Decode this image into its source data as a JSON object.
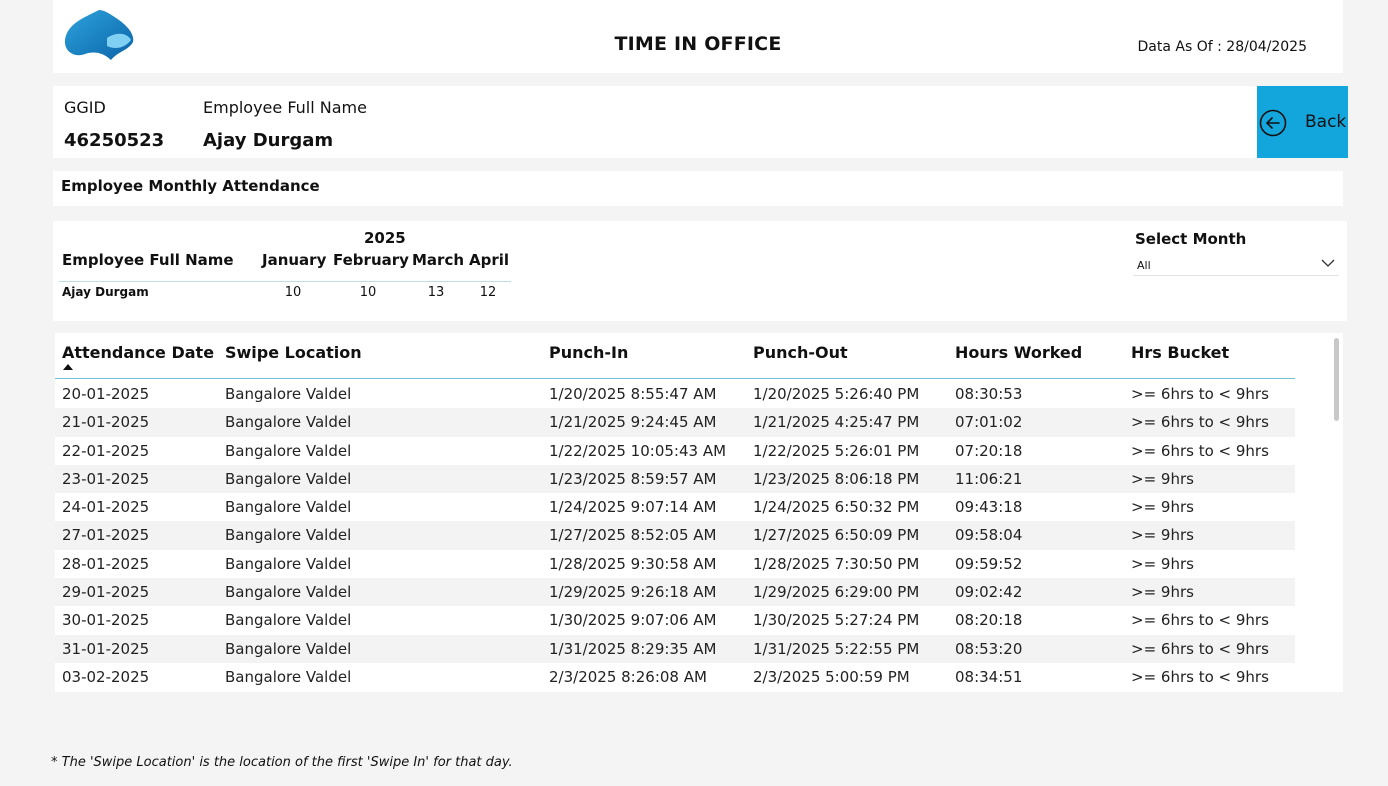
{
  "header": {
    "title": "TIME IN OFFICE",
    "data_as_of": "Data As Of : 28/04/2025",
    "logo_icon": "spade-logo-icon"
  },
  "employee": {
    "ggid_label": "GGID",
    "ggid_value": "46250523",
    "name_label": "Employee Full Name",
    "name_value": "Ajay Durgam"
  },
  "back_button": {
    "label": "Back",
    "icon": "arrow-left-circle-icon",
    "color": "#12a6dc"
  },
  "section_title": "Employee Monthly Attendance",
  "matrix": {
    "year": "2025",
    "name_header": "Employee Full Name",
    "months": [
      "January",
      "February",
      "March",
      "April"
    ],
    "employee": "Ajay Durgam",
    "values": [
      "10",
      "10",
      "13",
      "12"
    ]
  },
  "month_filter": {
    "label": "Select Month",
    "selected": "All",
    "icon": "chevron-down-icon"
  },
  "table": {
    "columns": [
      "Attendance Date",
      "Swipe Location",
      "Punch-In",
      "Punch-Out",
      "Hours Worked",
      "Hrs Bucket"
    ],
    "sort_indicator": "sort-ascending-icon",
    "rows": [
      [
        "20-01-2025",
        "Bangalore Valdel",
        "1/20/2025 8:55:47 AM",
        "1/20/2025 5:26:40 PM",
        "08:30:53",
        ">= 6hrs to < 9hrs"
      ],
      [
        "21-01-2025",
        "Bangalore Valdel",
        "1/21/2025 9:24:45 AM",
        "1/21/2025 4:25:47 PM",
        "07:01:02",
        ">= 6hrs to < 9hrs"
      ],
      [
        "22-01-2025",
        "Bangalore Valdel",
        "1/22/2025 10:05:43 AM",
        "1/22/2025 5:26:01 PM",
        "07:20:18",
        ">= 6hrs to < 9hrs"
      ],
      [
        "23-01-2025",
        "Bangalore Valdel",
        "1/23/2025 8:59:57 AM",
        "1/23/2025 8:06:18 PM",
        "11:06:21",
        ">= 9hrs"
      ],
      [
        "24-01-2025",
        "Bangalore Valdel",
        "1/24/2025 9:07:14 AM",
        "1/24/2025 6:50:32 PM",
        "09:43:18",
        ">= 9hrs"
      ],
      [
        "27-01-2025",
        "Bangalore Valdel",
        "1/27/2025 8:52:05 AM",
        "1/27/2025 6:50:09 PM",
        "09:58:04",
        ">= 9hrs"
      ],
      [
        "28-01-2025",
        "Bangalore Valdel",
        "1/28/2025 9:30:58 AM",
        "1/28/2025 7:30:50 PM",
        "09:59:52",
        ">= 9hrs"
      ],
      [
        "29-01-2025",
        "Bangalore Valdel",
        "1/29/2025 9:26:18 AM",
        "1/29/2025 6:29:00 PM",
        "09:02:42",
        ">= 9hrs"
      ],
      [
        "30-01-2025",
        "Bangalore Valdel",
        "1/30/2025 9:07:06 AM",
        "1/30/2025 5:27:24 PM",
        "08:20:18",
        ">= 6hrs to < 9hrs"
      ],
      [
        "31-01-2025",
        "Bangalore Valdel",
        "1/31/2025 8:29:35 AM",
        "1/31/2025 5:22:55 PM",
        "08:53:20",
        ">= 6hrs to < 9hrs"
      ],
      [
        "03-02-2025",
        "Bangalore Valdel",
        "2/3/2025 8:26:08 AM",
        "2/3/2025 5:00:59 PM",
        "08:34:51",
        ">= 6hrs to < 9hrs"
      ]
    ]
  },
  "footnote": "* The 'Swipe Location' is the location of the first 'Swipe In' for that day."
}
